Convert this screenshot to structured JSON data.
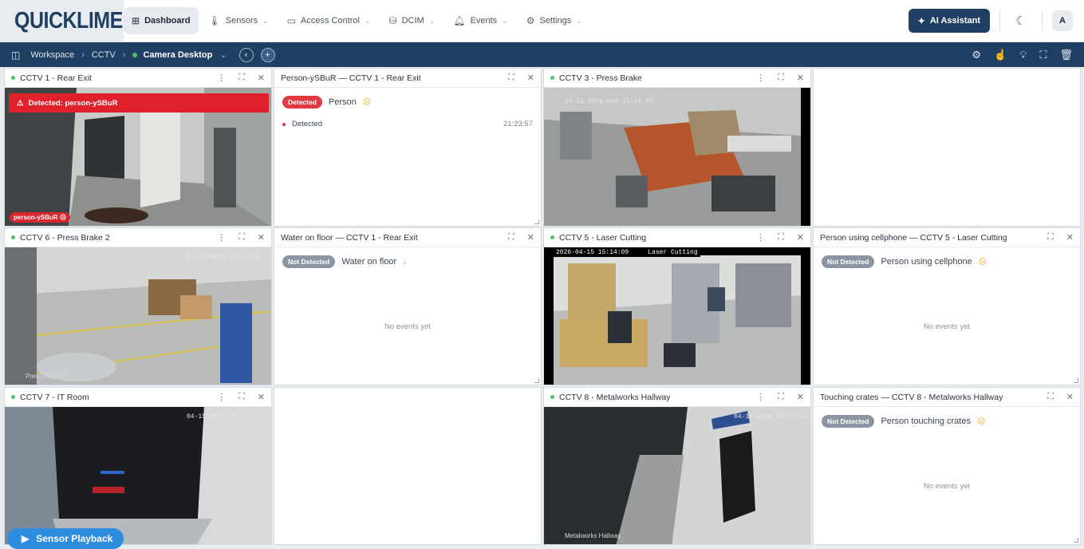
{
  "app": {
    "logo": "QUICKLIME"
  },
  "nav": [
    {
      "label": "Dashboard",
      "icon": "grid-icon",
      "active": true
    },
    {
      "label": "Sensors",
      "icon": "thermometer-icon"
    },
    {
      "label": "Access Control",
      "icon": "card-icon"
    },
    {
      "label": "DCIM",
      "icon": "server-icon"
    },
    {
      "label": "Events",
      "icon": "bell-icon"
    },
    {
      "label": "Settings",
      "icon": "gear-icon"
    }
  ],
  "ai_button": "AI Assistant",
  "avatar": "A",
  "breadcrumb": {
    "workspace": "Workspace",
    "cctv": "CCTV",
    "current": "Camera Desktop"
  },
  "panels": {
    "cam1": {
      "title": "CCTV 1 - Rear Exit",
      "alert": "Detected: person-ySBuR",
      "tag": "person-ySBuR"
    },
    "ev1": {
      "title": "Person-ySBuR — CCTV 1 - Rear Exit",
      "badge": "Detected",
      "label": "Person",
      "row_label": "Detected",
      "row_time": "21:23:57"
    },
    "cam3": {
      "title": "CCTV 3 - Press Brake",
      "timestamp": "04-15-2026 Wed 15:14:09"
    },
    "cam6": {
      "title": "CCTV 6 - Press Brake 2",
      "timestamp": "04-15-2026 15:14:14",
      "camname": "Press Brake 2"
    },
    "ev2": {
      "title": "Water on floor — CCTV 1 - Rear Exit",
      "badge": "Not Detected",
      "label": "Water on floor",
      "empty": "No events yet"
    },
    "cam5": {
      "title": "CCTV 5 - Laser Cutting",
      "timestamp": "2026-04-15 15:14:09     Laser Cutting"
    },
    "ev3": {
      "title": "Person using cellphone — CCTV 5 - Laser Cutting",
      "badge": "Not Detected",
      "label": "Person using cellphone",
      "empty": "No events yet"
    },
    "cam7": {
      "title": "CCTV 7 - IT Room",
      "timestamp": "04-15-2026 15:14:14"
    },
    "cam8": {
      "title": "CCTV 8 - Metalworks Hallway",
      "timestamp": "04-15-2026 15:14:14",
      "camname": "Metalworks Hallway"
    },
    "ev4": {
      "title": "Touching crates — CCTV 8 - Metalworks Hallway",
      "badge": "Not Detected",
      "label": "Person touching crates",
      "empty": "No events yet"
    }
  },
  "playback": "Sensor Playback"
}
